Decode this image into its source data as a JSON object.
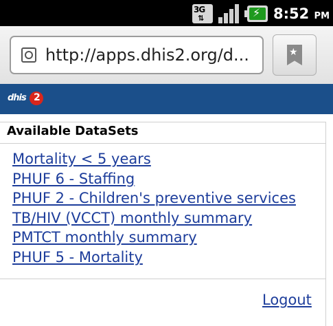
{
  "status_bar": {
    "network": "3G",
    "time": "8:52",
    "ampm": "PM",
    "icons": [
      "3g-data-icon",
      "signal-strength-icon",
      "battery-charging-icon"
    ]
  },
  "browser": {
    "url": "http://apps.dhis2.org/d...",
    "icons": [
      "globe-icon",
      "bookmark-icon"
    ]
  },
  "header": {
    "logo_text": "dhis",
    "logo_number": "2",
    "brand_color": "#1b4f8a"
  },
  "datasets": {
    "title": "Available DataSets",
    "items": [
      {
        "label": "Mortality < 5 years"
      },
      {
        "label": "PHUF 6 - Staffing"
      },
      {
        "label": "PHUF 2 - Children's preventive services"
      },
      {
        "label": "TB/HIV (VCCT) monthly summary"
      },
      {
        "label": "PMTCT monthly summary"
      },
      {
        "label": "PHUF 5 - Mortality"
      }
    ]
  },
  "footer": {
    "logout_label": "Logout"
  },
  "colors": {
    "link": "#1d3d9b",
    "status_bar": "#000000"
  }
}
